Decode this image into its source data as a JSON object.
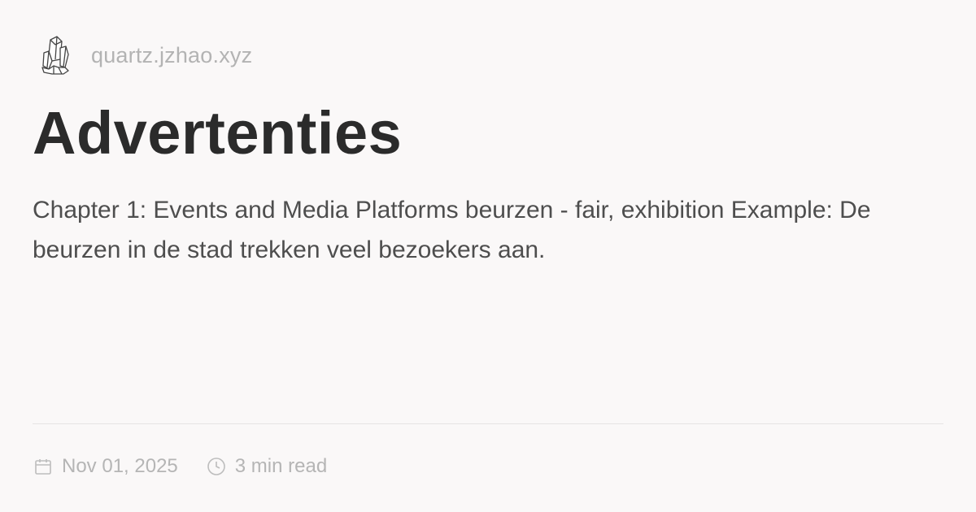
{
  "site": {
    "name": "quartz.jzhao.xyz",
    "logo_icon": "crystal-icon"
  },
  "page": {
    "title": "Advertenties",
    "description": "Chapter 1: Events and Media Platforms beurzen - fair, exhibition Example: De beurzen in de stad trekken veel bezoekers aan."
  },
  "meta": {
    "date": "Nov 01, 2025",
    "date_icon": "calendar-icon",
    "reading_time": "3 min read",
    "reading_time_icon": "clock-icon"
  },
  "colors": {
    "background": "#faf8f8",
    "title": "#2b2b2b",
    "text": "#4e4e4e",
    "muted": "#b5b5b5"
  }
}
